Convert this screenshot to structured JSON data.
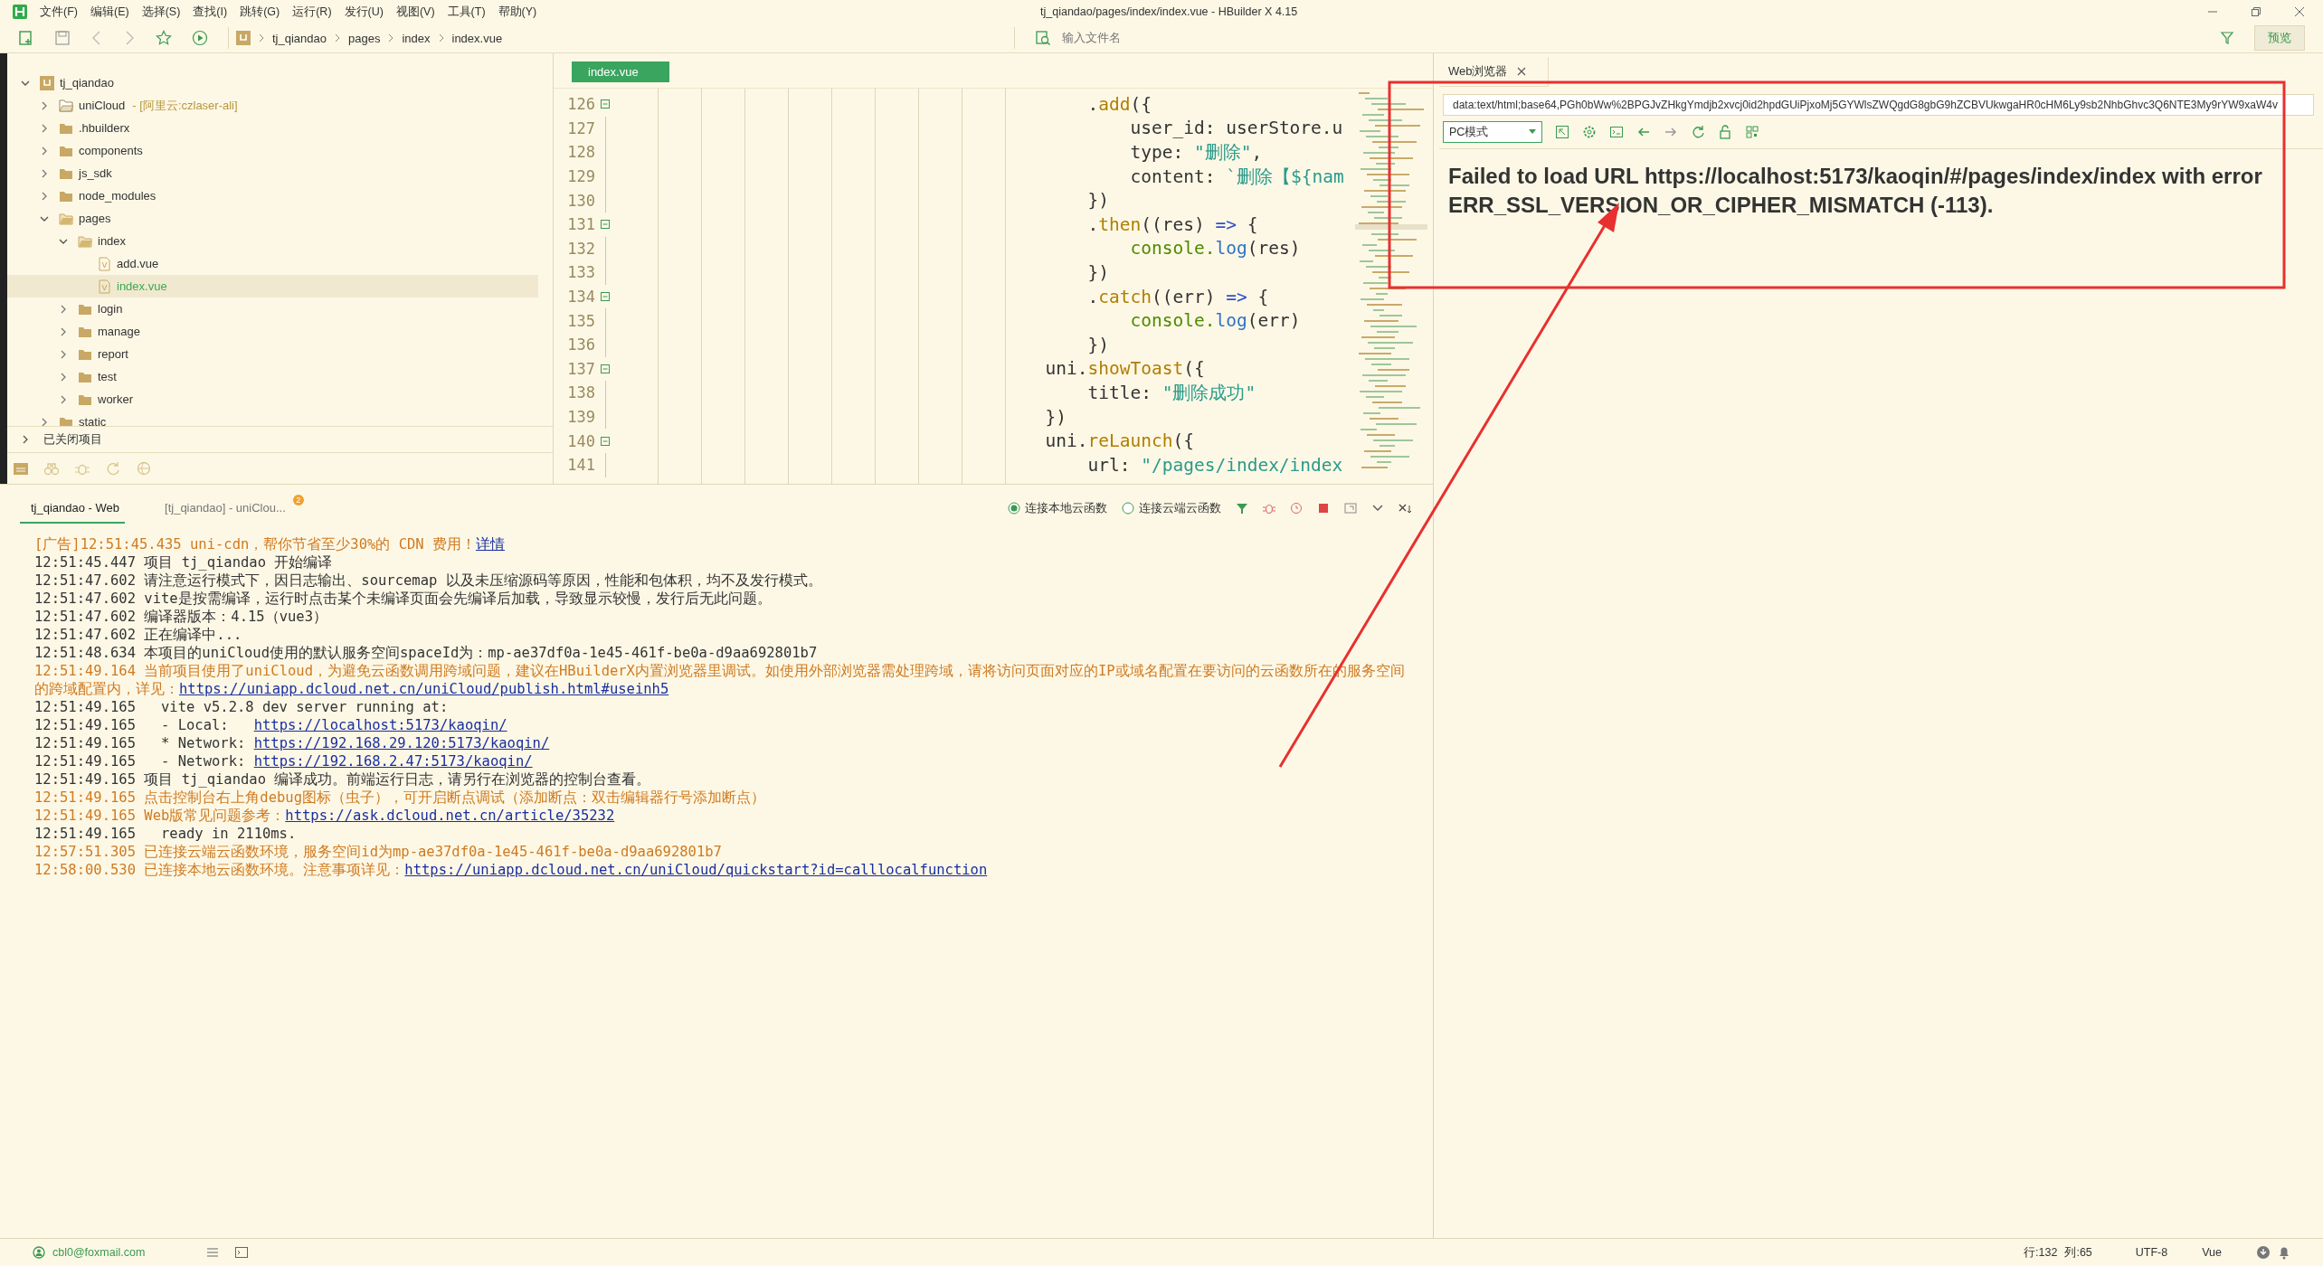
{
  "window": {
    "title": "tj_qiandao/pages/index/index.vue - HBuilder X 4.15"
  },
  "menu": [
    "文件(F)",
    "编辑(E)",
    "选择(S)",
    "查找(I)",
    "跳转(G)",
    "运行(R)",
    "发行(U)",
    "视图(V)",
    "工具(T)",
    "帮助(Y)"
  ],
  "toolbar": {
    "breadcrumb": [
      "tj_qiandao",
      "pages",
      "index",
      "index.vue"
    ],
    "search": {
      "placeholder": "输入文件名"
    },
    "preview_button": "预览"
  },
  "project_tree": {
    "root": {
      "label": "tj_qiandao",
      "kind": "project",
      "expanded": true,
      "selected": false,
      "children": [
        {
          "label": "uniCloud",
          "kind": "cloud",
          "note": "- [阿里云:czlaser-ali]",
          "expanded": false,
          "selected": false
        },
        {
          "label": ".hbuilderx",
          "kind": "folder",
          "expanded": false,
          "selected": false
        },
        {
          "label": "components",
          "kind": "folder",
          "expanded": false,
          "selected": false
        },
        {
          "label": "js_sdk",
          "kind": "folder",
          "expanded": false,
          "selected": false
        },
        {
          "label": "node_modules",
          "kind": "folder",
          "expanded": false,
          "selected": false
        },
        {
          "label": "pages",
          "kind": "folder",
          "expanded": true,
          "selected": false,
          "children": [
            {
              "label": "index",
              "kind": "folder",
              "expanded": true,
              "selected": false,
              "children": [
                {
                  "label": "add.vue",
                  "kind": "file",
                  "selected": false
                },
                {
                  "label": "index.vue",
                  "kind": "file",
                  "selected": true
                }
              ]
            },
            {
              "label": "login",
              "kind": "folder",
              "expanded": false,
              "selected": false
            },
            {
              "label": "manage",
              "kind": "folder",
              "expanded": false,
              "selected": false
            },
            {
              "label": "report",
              "kind": "folder",
              "expanded": false,
              "selected": false
            },
            {
              "label": "test",
              "kind": "folder",
              "expanded": false,
              "selected": false
            },
            {
              "label": "worker",
              "kind": "folder",
              "expanded": false,
              "selected": false
            }
          ]
        },
        {
          "label": "static",
          "kind": "folder",
          "expanded": false,
          "selected": false
        }
      ]
    },
    "closed_projects": {
      "label": "已关闭项目",
      "expanded": false
    }
  },
  "editor": {
    "tab": {
      "label": "index.vue",
      "selected": true
    },
    "lines": [
      {
        "number": "126",
        "fold": true,
        "tokens": [
          {
            "kind": "plain",
            "t": "                                            ."
          },
          {
            "kind": "function",
            "t": "add"
          },
          {
            "kind": "plain",
            "t": "({"
          }
        ]
      },
      {
        "number": "127",
        "fold": false,
        "tokens": [
          {
            "kind": "plain",
            "t": "                                                user_id: userStore.u"
          }
        ]
      },
      {
        "number": "128",
        "fold": false,
        "tokens": [
          {
            "kind": "plain",
            "t": "                                                type: "
          },
          {
            "kind": "string",
            "t": "\"删除\""
          },
          {
            "kind": "plain",
            "t": ","
          }
        ]
      },
      {
        "number": "129",
        "fold": false,
        "tokens": [
          {
            "kind": "plain",
            "t": "                                                content: "
          },
          {
            "kind": "string",
            "t": "`删除【${nam"
          }
        ]
      },
      {
        "number": "130",
        "fold": false,
        "tokens": [
          {
            "kind": "plain",
            "t": "                                            })"
          }
        ]
      },
      {
        "number": "131",
        "fold": true,
        "tokens": [
          {
            "kind": "plain",
            "t": "                                            ."
          },
          {
            "kind": "function",
            "t": "then"
          },
          {
            "kind": "plain",
            "t": "((res) "
          },
          {
            "kind": "operator",
            "t": "=>"
          },
          {
            "kind": "plain",
            "t": " {"
          }
        ]
      },
      {
        "number": "132",
        "fold": false,
        "tokens": [
          {
            "kind": "object",
            "t": "                                                console."
          },
          {
            "kind": "method",
            "t": "log"
          },
          {
            "kind": "plain",
            "t": "(res)"
          }
        ]
      },
      {
        "number": "133",
        "fold": false,
        "tokens": [
          {
            "kind": "plain",
            "t": "                                            })"
          }
        ]
      },
      {
        "number": "134",
        "fold": true,
        "tokens": [
          {
            "kind": "plain",
            "t": "                                            ."
          },
          {
            "kind": "function",
            "t": "catch"
          },
          {
            "kind": "plain",
            "t": "((err) "
          },
          {
            "kind": "operator",
            "t": "=>"
          },
          {
            "kind": "plain",
            "t": " {"
          }
        ]
      },
      {
        "number": "135",
        "fold": false,
        "tokens": [
          {
            "kind": "object",
            "t": "                                                console."
          },
          {
            "kind": "method",
            "t": "log"
          },
          {
            "kind": "plain",
            "t": "(err)"
          }
        ]
      },
      {
        "number": "136",
        "fold": false,
        "tokens": [
          {
            "kind": "plain",
            "t": "                                            })"
          }
        ]
      },
      {
        "number": "137",
        "fold": true,
        "tokens": [
          {
            "kind": "plain",
            "t": "                                        uni."
          },
          {
            "kind": "function",
            "t": "showToast"
          },
          {
            "kind": "plain",
            "t": "({"
          }
        ]
      },
      {
        "number": "138",
        "fold": false,
        "tokens": [
          {
            "kind": "plain",
            "t": "                                            title: "
          },
          {
            "kind": "string",
            "t": "\"删除成功\""
          }
        ]
      },
      {
        "number": "139",
        "fold": false,
        "tokens": [
          {
            "kind": "plain",
            "t": "                                        })"
          }
        ]
      },
      {
        "number": "140",
        "fold": true,
        "tokens": [
          {
            "kind": "plain",
            "t": "                                        uni."
          },
          {
            "kind": "function",
            "t": "reLaunch"
          },
          {
            "kind": "plain",
            "t": "({"
          }
        ]
      },
      {
        "number": "141",
        "fold": false,
        "tokens": [
          {
            "kind": "plain",
            "t": "                                            url: "
          },
          {
            "kind": "string",
            "t": "\"/pages/index/index"
          }
        ]
      }
    ]
  },
  "browser": {
    "tab": "Web浏览器",
    "url": "data:text/html;base64,PGh0bWw%2BPGJvZHkgYmdjb2xvcj0id2hpdGUiPjxoMj5GYWlsZWQgdG8gbG9hZCBVUkwgaHR0cHM6Ly9sb2NhbGhvc3Q6NTE3My9rYW9xaW4v",
    "mode": "PC模式",
    "message": "Failed to load URL https://localhost:5173/kaoqin/#/pages/index/index with error ERR_SSL_VERSION_OR_CIPHER_MISMATCH (-113)."
  },
  "console": {
    "tabs": [
      {
        "label": "tj_qiandao - Web",
        "selected": true
      },
      {
        "label": "[tj_qiandao] - uniClou...",
        "selected": false,
        "badge": "2"
      }
    ],
    "cloud_options": [
      {
        "label": "连接本地云函数",
        "selected": true
      },
      {
        "label": "连接云端云函数",
        "selected": false
      }
    ],
    "lines": [
      {
        "kind": "notice",
        "prefix": "[广告]",
        "time": "12:51:45.435",
        "text": "uni-cdn，帮你节省至少30%的 CDN 费用！",
        "link": "详情"
      },
      {
        "kind": "info",
        "time": "12:51:45.447",
        "text": "项目 tj_qiandao 开始编译"
      },
      {
        "kind": "info",
        "time": "12:51:47.602",
        "text": "请注意运行模式下，因日志输出、sourcemap 以及未压缩源码等原因，性能和包体积，均不及发行模式。"
      },
      {
        "kind": "info",
        "time": "12:51:47.602",
        "text": "vite是按需编译，运行时点击某个未编译页面会先编译后加载，导致显示较慢，发行后无此问题。"
      },
      {
        "kind": "info",
        "time": "12:51:47.602",
        "text": "编译器版本：4.15（vue3）"
      },
      {
        "kind": "info",
        "time": "12:51:47.602",
        "text": "正在编译中..."
      },
      {
        "kind": "info",
        "time": "12:51:48.634",
        "text": "本项目的uniCloud使用的默认服务空间spaceId为：mp-ae37df0a-1e45-461f-be0a-d9aa692801b7"
      },
      {
        "kind": "notice",
        "time": "12:51:49.164",
        "text": "当前项目使用了uniCloud，为避免云函数调用跨域问题，建议在HBuilderX内置浏览器里调试。如使用外部浏览器需处理跨域，请将访问页面对应的IP或域名配置在要访问的云函数所在的服务空间的跨域配置内，详见：",
        "link": "https://uniapp.dcloud.net.cn/uniCloud/publish.html#useinh5"
      },
      {
        "kind": "info",
        "time": "12:51:49.165",
        "text": "  vite v5.2.8 dev server running at:"
      },
      {
        "kind": "info",
        "time": "12:51:49.165",
        "text": "  - Local:   ",
        "link": "https://localhost:5173/kaoqin/"
      },
      {
        "kind": "info",
        "time": "12:51:49.165",
        "text": "  * Network: ",
        "link": "https://192.168.29.120:5173/kaoqin/"
      },
      {
        "kind": "info",
        "time": "12:51:49.165",
        "text": "  - Network: ",
        "link": "https://192.168.2.47:5173/kaoqin/"
      },
      {
        "kind": "info",
        "time": "12:51:49.165",
        "text": "项目 tj_qiandao 编译成功。前端运行日志，请另行在浏览器的控制台查看。"
      },
      {
        "kind": "notice",
        "time": "12:51:49.165",
        "text": "点击控制台右上角debug图标（虫子），可开启断点调试（添加断点：双击编辑器行号添加断点）"
      },
      {
        "kind": "notice",
        "time": "12:51:49.165",
        "text": "Web版常见问题参考：",
        "link": "https://ask.dcloud.net.cn/article/35232"
      },
      {
        "kind": "info",
        "time": "12:51:49.165",
        "text": "  ready in 2110ms."
      },
      {
        "kind": "notice",
        "time": "12:57:51.305",
        "text": "已连接云端云函数环境，服务空间id为mp-ae37df0a-1e45-461f-be0a-d9aa692801b7"
      },
      {
        "kind": "notice",
        "time": "12:58:00.530",
        "text": "已连接本地云函数环境。注意事项详见：",
        "link": "https://uniapp.dcloud.net.cn/uniCloud/quickstart?id=calllocalfunction"
      }
    ]
  },
  "status_bar": {
    "user": "cbl0@foxmail.com",
    "line": "行:132",
    "column": "列:65",
    "encoding": "UTF-8",
    "language": "Vue"
  },
  "annotation": {
    "highlight_box": true,
    "pointer_arrow": true
  }
}
